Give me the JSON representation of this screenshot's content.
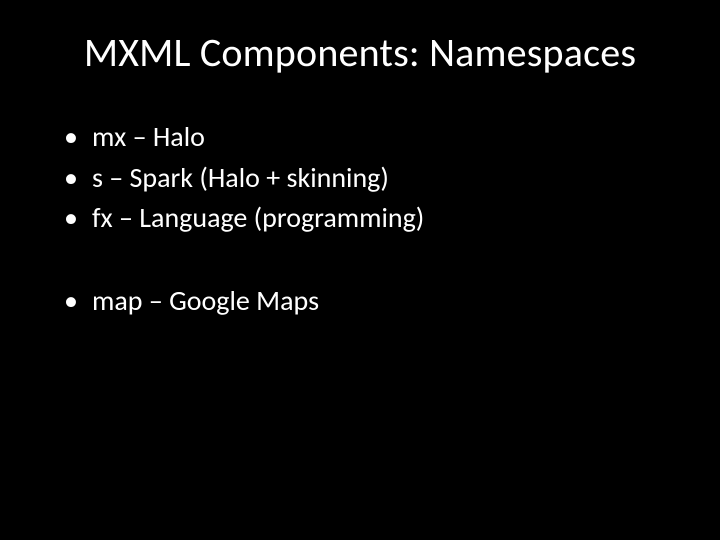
{
  "title": "MXML Components: Namespaces",
  "bullets_group1": [
    "mx – Halo",
    "s – Spark (Halo + skinning)",
    "fx – Language (programming)"
  ],
  "bullets_group2": [
    "map – Google Maps"
  ]
}
